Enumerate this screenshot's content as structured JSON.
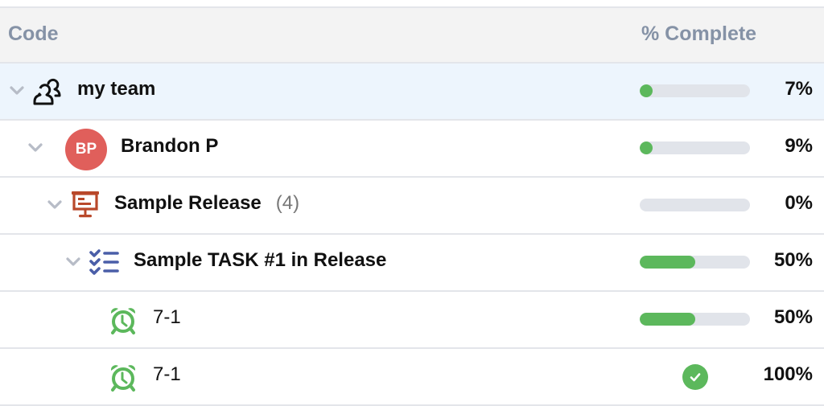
{
  "colors": {
    "progress_fill": "#5cb85c",
    "progress_track": "#e1e4ea",
    "selected_row": "#edf5fd",
    "avatar_bg": "#e05f5b",
    "release_icon": "#b9482a",
    "task_icon": "#4a5ea8",
    "timer_icon": "#5cb85c",
    "header_text": "#8592a6"
  },
  "header": {
    "code_label": "Code",
    "percent_label": "% Complete"
  },
  "rows": [
    {
      "type": "team",
      "icon": "team-icon",
      "label": "my team",
      "progress": 7,
      "percent_text": "7%",
      "expanded": true,
      "selected": true
    },
    {
      "type": "user",
      "avatar_initials": "BP",
      "label": "Brandon P",
      "progress": 9,
      "percent_text": "9%",
      "expanded": true
    },
    {
      "type": "release",
      "icon": "presentation-board-icon",
      "label": "Sample Release",
      "count": "(4)",
      "progress": 0,
      "percent_text": "0%",
      "expanded": true
    },
    {
      "type": "task",
      "icon": "checklist-icon",
      "label": "Sample TASK #1 in Release",
      "progress": 50,
      "percent_text": "50%",
      "expanded": true
    },
    {
      "type": "timer",
      "icon": "alarm-clock-icon",
      "label": "7-1",
      "progress": 50,
      "percent_text": "50%"
    },
    {
      "type": "timer",
      "icon": "alarm-clock-icon",
      "label": "7-1",
      "progress": 100,
      "percent_text": "100%",
      "complete": true,
      "status_icon": "check-circle-icon"
    }
  ]
}
